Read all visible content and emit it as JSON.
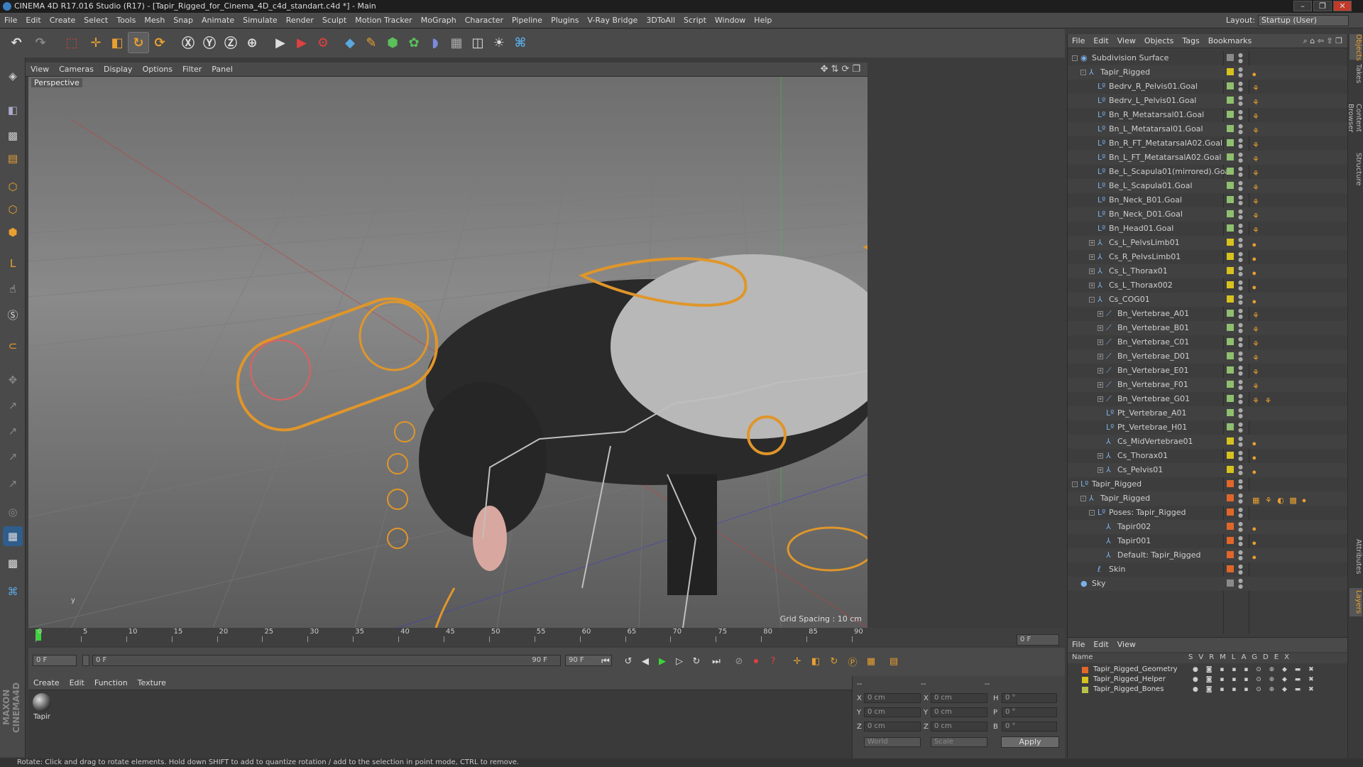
{
  "window": {
    "title": "CINEMA 4D R17.016 Studio (R17) - [Tapir_Rigged_for_Cinema_4D_c4d_standart.c4d *] - Main"
  },
  "menubar": {
    "items": [
      "File",
      "Edit",
      "Create",
      "Select",
      "Tools",
      "Mesh",
      "Snap",
      "Animate",
      "Simulate",
      "Render",
      "Sculpt",
      "Motion Tracker",
      "MoGraph",
      "Character",
      "Pipeline",
      "Plugins",
      "V-Ray Bridge",
      "3DToAll",
      "Script",
      "Window",
      "Help"
    ],
    "layout_label": "Layout:",
    "layout_value": "Startup (User)"
  },
  "viewport": {
    "menu": [
      "View",
      "Cameras",
      "Display",
      "Options",
      "Filter",
      "Panel"
    ],
    "camera_label": "Perspective",
    "grid_spacing": "Grid Spacing : 10 cm"
  },
  "timeline": {
    "ticks": [
      "0",
      "5",
      "10",
      "15",
      "20",
      "25",
      "30",
      "35",
      "40",
      "45",
      "50",
      "55",
      "60",
      "65",
      "70",
      "75",
      "80",
      "85",
      "90"
    ],
    "end_frame": "0 F"
  },
  "transport": {
    "current_frame": "0 F",
    "range_start": "0 F",
    "range_end": "90 F",
    "max_frame": "90 F"
  },
  "material_manager": {
    "menu": [
      "Create",
      "Edit",
      "Function",
      "Texture"
    ],
    "material_name": "Tapir"
  },
  "coordinates": {
    "header": [
      "--",
      "--",
      "--"
    ],
    "rows": [
      {
        "a": "X",
        "av": "0 cm",
        "b": "X",
        "bv": "0 cm",
        "c": "H",
        "cv": "0 °"
      },
      {
        "a": "Y",
        "av": "0 cm",
        "b": "Y",
        "bv": "0 cm",
        "c": "P",
        "cv": "0 °"
      },
      {
        "a": "Z",
        "av": "0 cm",
        "b": "Z",
        "bv": "0 cm",
        "c": "B",
        "cv": "0 °"
      }
    ],
    "space": "World",
    "mode": "Scale",
    "apply_label": "Apply"
  },
  "status": {
    "text": "Rotate: Click and drag to rotate elements. Hold down SHIFT to add to quantize rotation / add to the selection in point mode, CTRL to remove."
  },
  "object_manager": {
    "menu": [
      "File",
      "Edit",
      "View",
      "Objects",
      "Tags",
      "Bookmarks"
    ],
    "rows": [
      {
        "name": "Subdivision Surface",
        "depth": 0,
        "exp": "-",
        "icon": "◉",
        "color": "#8a8a8a",
        "tags": ""
      },
      {
        "name": "Tapir_Rigged",
        "depth": 1,
        "exp": "-",
        "icon": "⅄",
        "color": "#d8c21f",
        "tags": "⦁"
      },
      {
        "name": "Bedrv_R_Pelvis01.Goal",
        "depth": 2,
        "exp": "",
        "icon": "Lº",
        "color": "#8fbf6f",
        "tags": "⚘"
      },
      {
        "name": "Bedrv_L_Pelvis01.Goal",
        "depth": 2,
        "exp": "",
        "icon": "Lº",
        "color": "#8fbf6f",
        "tags": "⚘"
      },
      {
        "name": "Bn_R_Metatarsal01.Goal",
        "depth": 2,
        "exp": "",
        "icon": "Lº",
        "color": "#8fbf6f",
        "tags": "⚘"
      },
      {
        "name": "Bn_L_Metatarsal01.Goal",
        "depth": 2,
        "exp": "",
        "icon": "Lº",
        "color": "#8fbf6f",
        "tags": "⚘"
      },
      {
        "name": "Bn_R_FT_MetatarsalA02.Goal",
        "depth": 2,
        "exp": "",
        "icon": "Lº",
        "color": "#8fbf6f",
        "tags": "⚘"
      },
      {
        "name": "Bn_L_FT_MetatarsalA02.Goal",
        "depth": 2,
        "exp": "",
        "icon": "Lº",
        "color": "#8fbf6f",
        "tags": "⚘"
      },
      {
        "name": "Be_L_Scapula01(mirrored).Goal",
        "depth": 2,
        "exp": "",
        "icon": "Lº",
        "color": "#8fbf6f",
        "tags": "⚘"
      },
      {
        "name": "Be_L_Scapula01.Goal",
        "depth": 2,
        "exp": "",
        "icon": "Lº",
        "color": "#8fbf6f",
        "tags": "⚘"
      },
      {
        "name": "Bn_Neck_B01.Goal",
        "depth": 2,
        "exp": "",
        "icon": "Lº",
        "color": "#8fbf6f",
        "tags": "⚘"
      },
      {
        "name": "Bn_Neck_D01.Goal",
        "depth": 2,
        "exp": "",
        "icon": "Lº",
        "color": "#8fbf6f",
        "tags": "⚘"
      },
      {
        "name": "Bn_Head01.Goal",
        "depth": 2,
        "exp": "",
        "icon": "Lº",
        "color": "#8fbf6f",
        "tags": "⚘"
      },
      {
        "name": "Cs_L_PelvsLimb01",
        "depth": 2,
        "exp": "+",
        "icon": "⅄",
        "color": "#d8c21f",
        "tags": "⦁"
      },
      {
        "name": "Cs_R_PelvsLimb01",
        "depth": 2,
        "exp": "+",
        "icon": "⅄",
        "color": "#d8c21f",
        "tags": "⦁"
      },
      {
        "name": "Cs_L_Thorax01",
        "depth": 2,
        "exp": "+",
        "icon": "⅄",
        "color": "#d8c21f",
        "tags": "⦁"
      },
      {
        "name": "Cs_L_Thorax002",
        "depth": 2,
        "exp": "+",
        "icon": "⅄",
        "color": "#d8c21f",
        "tags": "⦁"
      },
      {
        "name": "Cs_COG01",
        "depth": 2,
        "exp": "-",
        "icon": "⅄",
        "color": "#d8c21f",
        "tags": "⦁"
      },
      {
        "name": "Bn_Vertebrae_A01",
        "depth": 3,
        "exp": "+",
        "icon": "⟋",
        "color": "#8fbf6f",
        "tags": "⚘"
      },
      {
        "name": "Bn_Vertebrae_B01",
        "depth": 3,
        "exp": "+",
        "icon": "⟋",
        "color": "#8fbf6f",
        "tags": "⚘"
      },
      {
        "name": "Bn_Vertebrae_C01",
        "depth": 3,
        "exp": "+",
        "icon": "⟋",
        "color": "#8fbf6f",
        "tags": "⚘"
      },
      {
        "name": "Bn_Vertebrae_D01",
        "depth": 3,
        "exp": "+",
        "icon": "⟋",
        "color": "#8fbf6f",
        "tags": "⚘"
      },
      {
        "name": "Bn_Vertebrae_E01",
        "depth": 3,
        "exp": "+",
        "icon": "⟋",
        "color": "#8fbf6f",
        "tags": "⚘"
      },
      {
        "name": "Bn_Vertebrae_F01",
        "depth": 3,
        "exp": "+",
        "icon": "⟋",
        "color": "#8fbf6f",
        "tags": "⚘"
      },
      {
        "name": "Bn_Vertebrae_G01",
        "depth": 3,
        "exp": "+",
        "icon": "⟋",
        "color": "#8fbf6f",
        "tags": "⚘ ⚘"
      },
      {
        "name": "Pt_Vertebrae_A01",
        "depth": 3,
        "exp": "",
        "icon": "Lº",
        "color": "#8fbf6f",
        "tags": ""
      },
      {
        "name": "Pt_Vertebrae_H01",
        "depth": 3,
        "exp": "",
        "icon": "Lº",
        "color": "#8fbf6f",
        "tags": ""
      },
      {
        "name": "Cs_MidVertebrae01",
        "depth": 3,
        "exp": "",
        "icon": "⅄",
        "color": "#d8c21f",
        "tags": "⦁"
      },
      {
        "name": "Cs_Thorax01",
        "depth": 3,
        "exp": "+",
        "icon": "⅄",
        "color": "#d8c21f",
        "tags": "⦁"
      },
      {
        "name": "Cs_Pelvis01",
        "depth": 3,
        "exp": "+",
        "icon": "⅄",
        "color": "#d8c21f",
        "tags": "⦁"
      },
      {
        "name": "Tapir_Rigged",
        "depth": 0,
        "exp": "-",
        "icon": "Lº",
        "color": "#e0662a",
        "tags": ""
      },
      {
        "name": "Tapir_Rigged",
        "depth": 1,
        "exp": "-",
        "icon": "⅄",
        "color": "#e0662a",
        "tags": "▦ ⚘ ◐ ▩ ⦁"
      },
      {
        "name": "Poses: Tapir_Rigged",
        "depth": 2,
        "exp": "-",
        "icon": "Lº",
        "color": "#e0662a",
        "tags": ""
      },
      {
        "name": "Tapir002",
        "depth": 3,
        "exp": "",
        "icon": "⅄",
        "color": "#e0662a",
        "tags": "⦁"
      },
      {
        "name": "Tapir001",
        "depth": 3,
        "exp": "",
        "icon": "⅄",
        "color": "#e0662a",
        "tags": "⦁"
      },
      {
        "name": "Default: Tapir_Rigged",
        "depth": 3,
        "exp": "",
        "icon": "⅄",
        "color": "#e0662a",
        "tags": "⦁"
      },
      {
        "name": "Skin",
        "depth": 2,
        "exp": "",
        "icon": "ℓ",
        "color": "#e0662a",
        "tags": ""
      },
      {
        "name": "Sky",
        "depth": 0,
        "exp": "",
        "icon": "●",
        "color": "#8a8a8a",
        "tags": ""
      }
    ]
  },
  "layer_manager": {
    "menu": [
      "File",
      "Edit",
      "View"
    ],
    "header_name": "Name",
    "header_flags": [
      "S",
      "V",
      "R",
      "M",
      "L",
      "A",
      "G",
      "D",
      "E",
      "X"
    ],
    "layers": [
      {
        "name": "Tapir_Rigged_Geometry",
        "color": "#e0662a"
      },
      {
        "name": "Tapir_Rigged_Helper",
        "color": "#d8c21f"
      },
      {
        "name": "Tapir_Rigged_Bones",
        "color": "#b8c24a"
      }
    ]
  },
  "right_tabs": [
    "Objects",
    "Takes",
    "Content Browser",
    "Structure",
    "Attributes",
    "Layers"
  ],
  "colors": {
    "accent": "#e8a030",
    "selection": "#2f5d8c"
  }
}
